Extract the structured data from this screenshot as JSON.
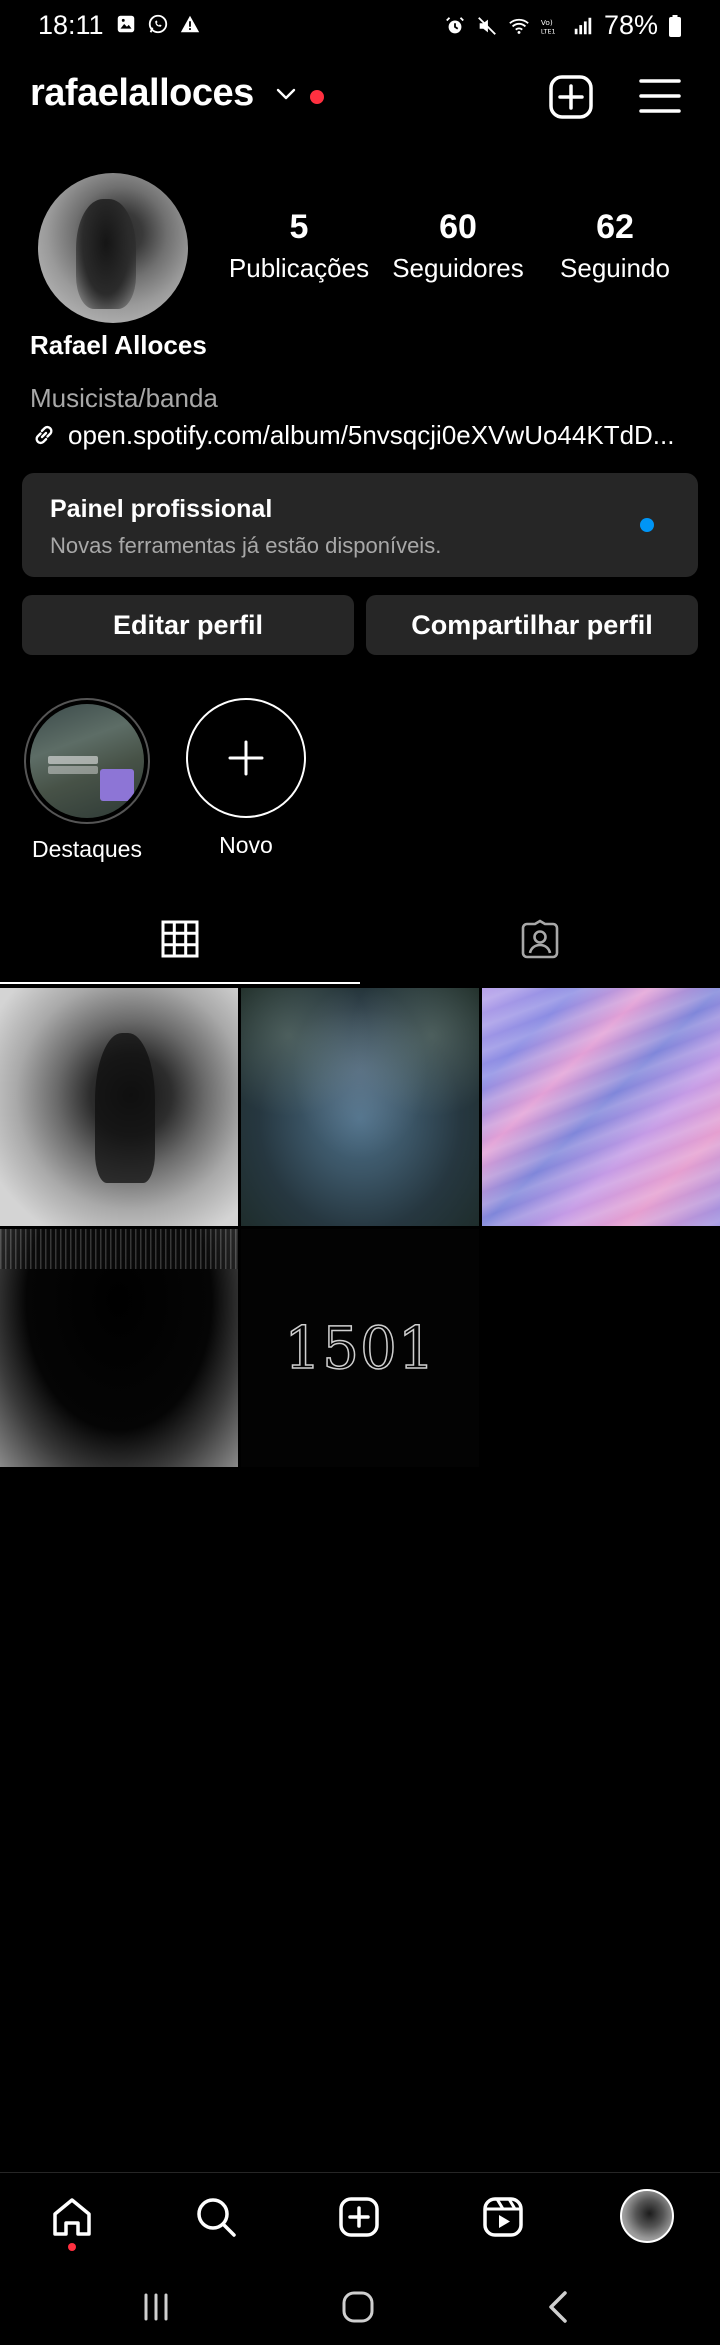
{
  "status_bar": {
    "time": "18:11",
    "battery": "78%",
    "left_icons": [
      "gallery-icon",
      "whatsapp-icon",
      "warning-icon"
    ],
    "right_icons": [
      "alarm-icon",
      "mute-icon",
      "wifi-icon",
      "volte-icon",
      "signal-icon",
      "battery-icon"
    ]
  },
  "header": {
    "username": "rafaelalloces",
    "notification_color": "#ff3040"
  },
  "profile": {
    "stats": {
      "posts_count": "5",
      "posts_label": "Publicações",
      "followers_count": "60",
      "followers_label": "Seguidores",
      "following_count": "62",
      "following_label": "Seguindo"
    },
    "full_name": "Rafael Alloces",
    "category": "Musicista/banda",
    "link": "open.spotify.com/album/5nvsqcji0eXVwUo44KTdD..."
  },
  "pro_panel": {
    "title": "Painel profissional",
    "subtitle": "Novas ferramentas já estão disponíveis.",
    "dot_color": "#0095f6"
  },
  "buttons": {
    "edit": "Editar perfil",
    "share": "Compartilhar perfil"
  },
  "highlights": [
    {
      "label": "Destaques"
    },
    {
      "label": "Novo"
    }
  ],
  "tabs": [
    {
      "name": "grid",
      "active": true
    },
    {
      "name": "tagged",
      "active": false
    }
  ],
  "posts": [
    {
      "caption": ""
    },
    {
      "caption": ""
    },
    {
      "caption": ""
    },
    {
      "caption": ""
    },
    {
      "caption": "1501"
    }
  ],
  "bottom_nav": [
    "home-icon",
    "search-icon",
    "create-icon",
    "reels-icon",
    "profile-avatar"
  ],
  "system_nav": [
    "recent-apps-icon",
    "home-button-icon",
    "back-icon"
  ]
}
